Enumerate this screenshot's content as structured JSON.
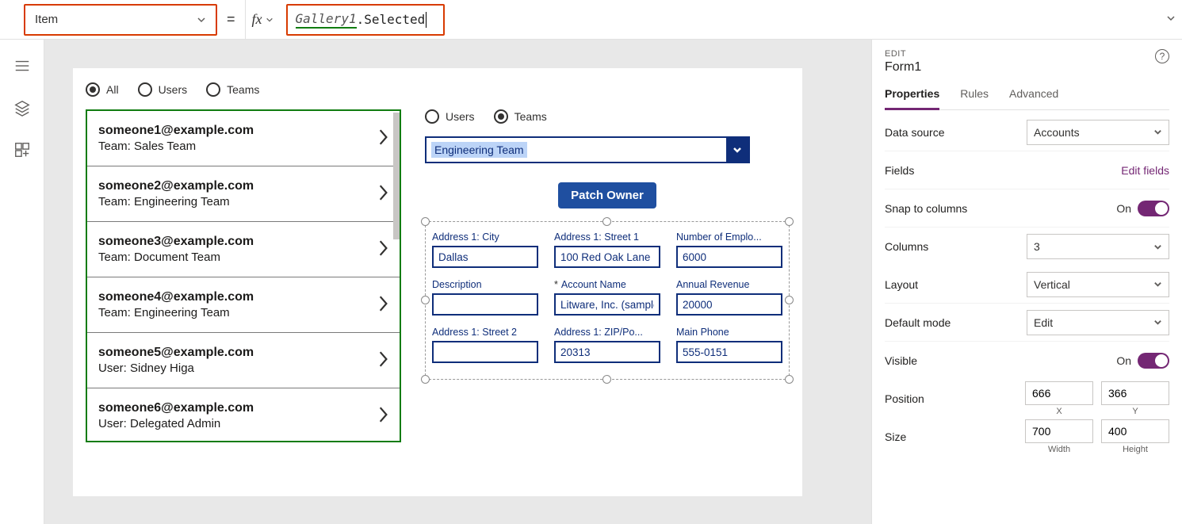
{
  "formulaBar": {
    "property": "Item",
    "equals": "=",
    "fx": "fx",
    "token1": "Gallery1",
    "token2": ".Selected"
  },
  "canvas": {
    "topRadios": {
      "all": "All",
      "users": "Users",
      "teams": "Teams"
    },
    "gallery": [
      {
        "email": "someone1@example.com",
        "sub": "Team: Sales Team"
      },
      {
        "email": "someone2@example.com",
        "sub": "Team: Engineering Team"
      },
      {
        "email": "someone3@example.com",
        "sub": "Team: Document Team"
      },
      {
        "email": "someone4@example.com",
        "sub": "Team: Engineering Team"
      },
      {
        "email": "someone5@example.com",
        "sub": "User: Sidney Higa"
      },
      {
        "email": "someone6@example.com",
        "sub": "User: Delegated Admin"
      }
    ],
    "rightRadios": {
      "users": "Users",
      "teams": "Teams"
    },
    "teamDropdown": "Engineering Team",
    "patchBtn": "Patch Owner",
    "form": {
      "fields": [
        {
          "label": "Address 1: City",
          "value": "Dallas",
          "req": false
        },
        {
          "label": "Address 1: Street 1",
          "value": "100 Red Oak Lane",
          "req": false
        },
        {
          "label": "Number of Emplo...",
          "value": "6000",
          "req": false
        },
        {
          "label": "Description",
          "value": "",
          "req": false
        },
        {
          "label": "Account Name",
          "value": "Litware, Inc. (sample",
          "req": true
        },
        {
          "label": "Annual Revenue",
          "value": "20000",
          "req": false
        },
        {
          "label": "Address 1: Street 2",
          "value": "",
          "req": false
        },
        {
          "label": "Address 1: ZIP/Po...",
          "value": "20313",
          "req": false
        },
        {
          "label": "Main Phone",
          "value": "555-0151",
          "req": false
        }
      ]
    }
  },
  "panel": {
    "kicker": "EDIT",
    "objectName": "Form1",
    "tabs": {
      "properties": "Properties",
      "rules": "Rules",
      "advanced": "Advanced"
    },
    "rows": {
      "dataSource": {
        "label": "Data source",
        "value": "Accounts"
      },
      "fields": {
        "label": "Fields",
        "link": "Edit fields"
      },
      "snap": {
        "label": "Snap to columns",
        "state": "On"
      },
      "columns": {
        "label": "Columns",
        "value": "3"
      },
      "layout": {
        "label": "Layout",
        "value": "Vertical"
      },
      "defaultMode": {
        "label": "Default mode",
        "value": "Edit"
      },
      "visible": {
        "label": "Visible",
        "state": "On"
      },
      "position": {
        "label": "Position",
        "x": "666",
        "y": "366",
        "xl": "X",
        "yl": "Y"
      },
      "size": {
        "label": "Size",
        "w": "700",
        "h": "400",
        "wl": "Width",
        "hl": "Height"
      }
    }
  }
}
